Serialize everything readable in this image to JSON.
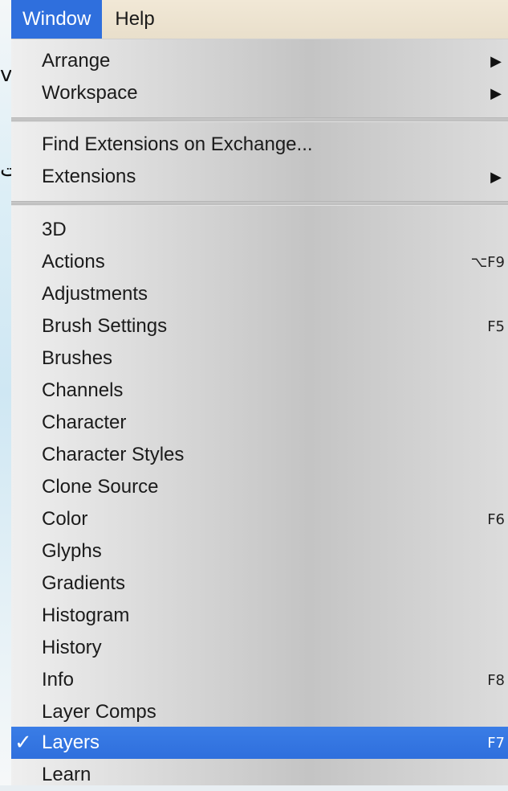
{
  "background_glyphs": [
    "v",
    "ت"
  ],
  "menubar": {
    "window_label": "Window",
    "help_label": "Help"
  },
  "menu": {
    "arrange": "Arrange",
    "workspace": "Workspace",
    "find_extensions": "Find Extensions on Exchange...",
    "extensions": "Extensions",
    "submenu_arrow": "▶",
    "panels": [
      {
        "label": "3D",
        "shortcut": ""
      },
      {
        "label": "Actions",
        "shortcut": "⌥F9"
      },
      {
        "label": "Adjustments",
        "shortcut": ""
      },
      {
        "label": "Brush Settings",
        "shortcut": "F5"
      },
      {
        "label": "Brushes",
        "shortcut": ""
      },
      {
        "label": "Channels",
        "shortcut": ""
      },
      {
        "label": "Character",
        "shortcut": ""
      },
      {
        "label": "Character Styles",
        "shortcut": ""
      },
      {
        "label": "Clone Source",
        "shortcut": ""
      },
      {
        "label": "Color",
        "shortcut": "F6"
      },
      {
        "label": "Glyphs",
        "shortcut": ""
      },
      {
        "label": "Gradients",
        "shortcut": ""
      },
      {
        "label": "Histogram",
        "shortcut": ""
      },
      {
        "label": "History",
        "shortcut": ""
      },
      {
        "label": "Info",
        "shortcut": "F8"
      },
      {
        "label": "Layer Comps",
        "shortcut": ""
      },
      {
        "label": "Layers",
        "shortcut": "F7",
        "checked": "✓"
      },
      {
        "label": "Learn",
        "shortcut": ""
      }
    ]
  },
  "colors": {
    "highlight": "#2f6fdd",
    "menubar_bg": "#eee5d1"
  }
}
